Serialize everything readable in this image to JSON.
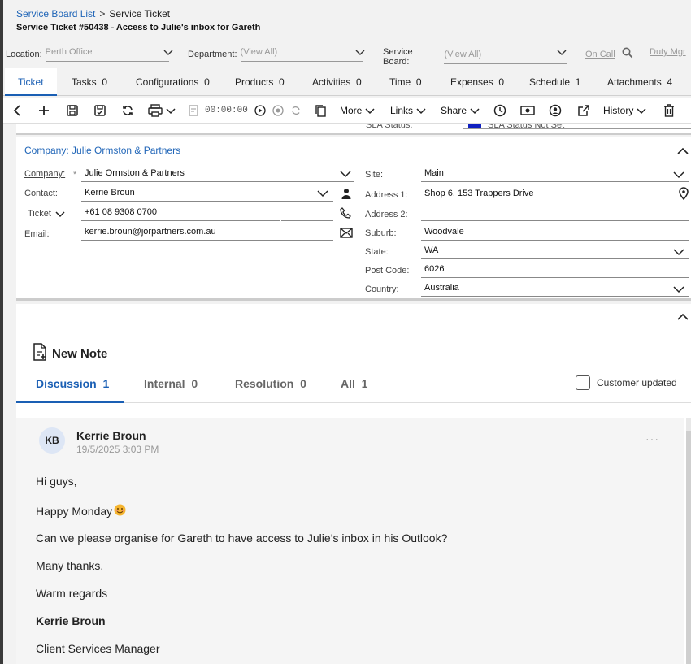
{
  "breadcrumb": {
    "root": "Service Board List",
    "current": "Service Ticket"
  },
  "ticket_title": "Service Ticket #50438 - Access to Julie's inbox for Gareth",
  "filters": {
    "location_label": "Location:",
    "location_value": "Perth Office",
    "department_label": "Department:",
    "department_value": "(View All)",
    "board_label": "Service Board:",
    "board_value": "(View All)",
    "on_call": "On Call",
    "duty_mgr": "Duty Mgr"
  },
  "tabs": [
    {
      "label": "Ticket",
      "count": ""
    },
    {
      "label": "Tasks",
      "count": "0"
    },
    {
      "label": "Configurations",
      "count": "0"
    },
    {
      "label": "Products",
      "count": "0"
    },
    {
      "label": "Activities",
      "count": "0"
    },
    {
      "label": "Time",
      "count": "0"
    },
    {
      "label": "Expenses",
      "count": "0"
    },
    {
      "label": "Schedule",
      "count": "1"
    },
    {
      "label": "Attachments",
      "count": "4"
    }
  ],
  "toolbar": {
    "timer": "00:00:00",
    "more": "More",
    "links": "Links",
    "share": "Share",
    "history": "History"
  },
  "sla": {
    "label": "SLA Status:",
    "value": "SLA Status Not Set",
    "color": "#1020c0"
  },
  "company_panel": {
    "title": "Company: Julie Ormston & Partners",
    "company_label": "Company:",
    "company_value": "Julie Ormston & Partners",
    "required_mark": "*",
    "contact_label": "Contact:",
    "contact_value": "Kerrie Broun",
    "phone_type": "Ticket",
    "phone_value": "+61 08 9308 0700",
    "email_label": "Email:",
    "email_value": "kerrie.broun@jorpartners.com.au",
    "site_label": "Site:",
    "site_value": "Main",
    "address1_label": "Address 1:",
    "address1_value": "Shop 6, 153 Trappers Drive",
    "address2_label": "Address 2:",
    "address2_value": "",
    "suburb_label": "Suburb:",
    "suburb_value": "Woodvale",
    "state_label": "State:",
    "state_value": "WA",
    "postcode_label": "Post Code:",
    "postcode_value": "6026",
    "country_label": "Country:",
    "country_value": "Australia"
  },
  "notes": {
    "new_note": "New Note",
    "tabs": [
      {
        "label": "Discussion",
        "count": "1"
      },
      {
        "label": "Internal",
        "count": "0"
      },
      {
        "label": "Resolution",
        "count": "0"
      },
      {
        "label": "All",
        "count": "1"
      }
    ],
    "customer_updated": "Customer updated",
    "entry": {
      "initials": "KB",
      "author": "Kerrie Broun",
      "timestamp": "19/5/2025 3:03 PM",
      "lines": [
        "Hi guys,",
        "Happy Monday",
        "Can we please organise for Gareth to have access to Julie’s inbox in his Outlook?",
        "Many thanks.",
        "Warm regards",
        "Kerrie Broun",
        "Client Services Manager"
      ]
    }
  },
  "colors": {
    "accent": "#1a5fb4",
    "link": "#2166b8"
  }
}
